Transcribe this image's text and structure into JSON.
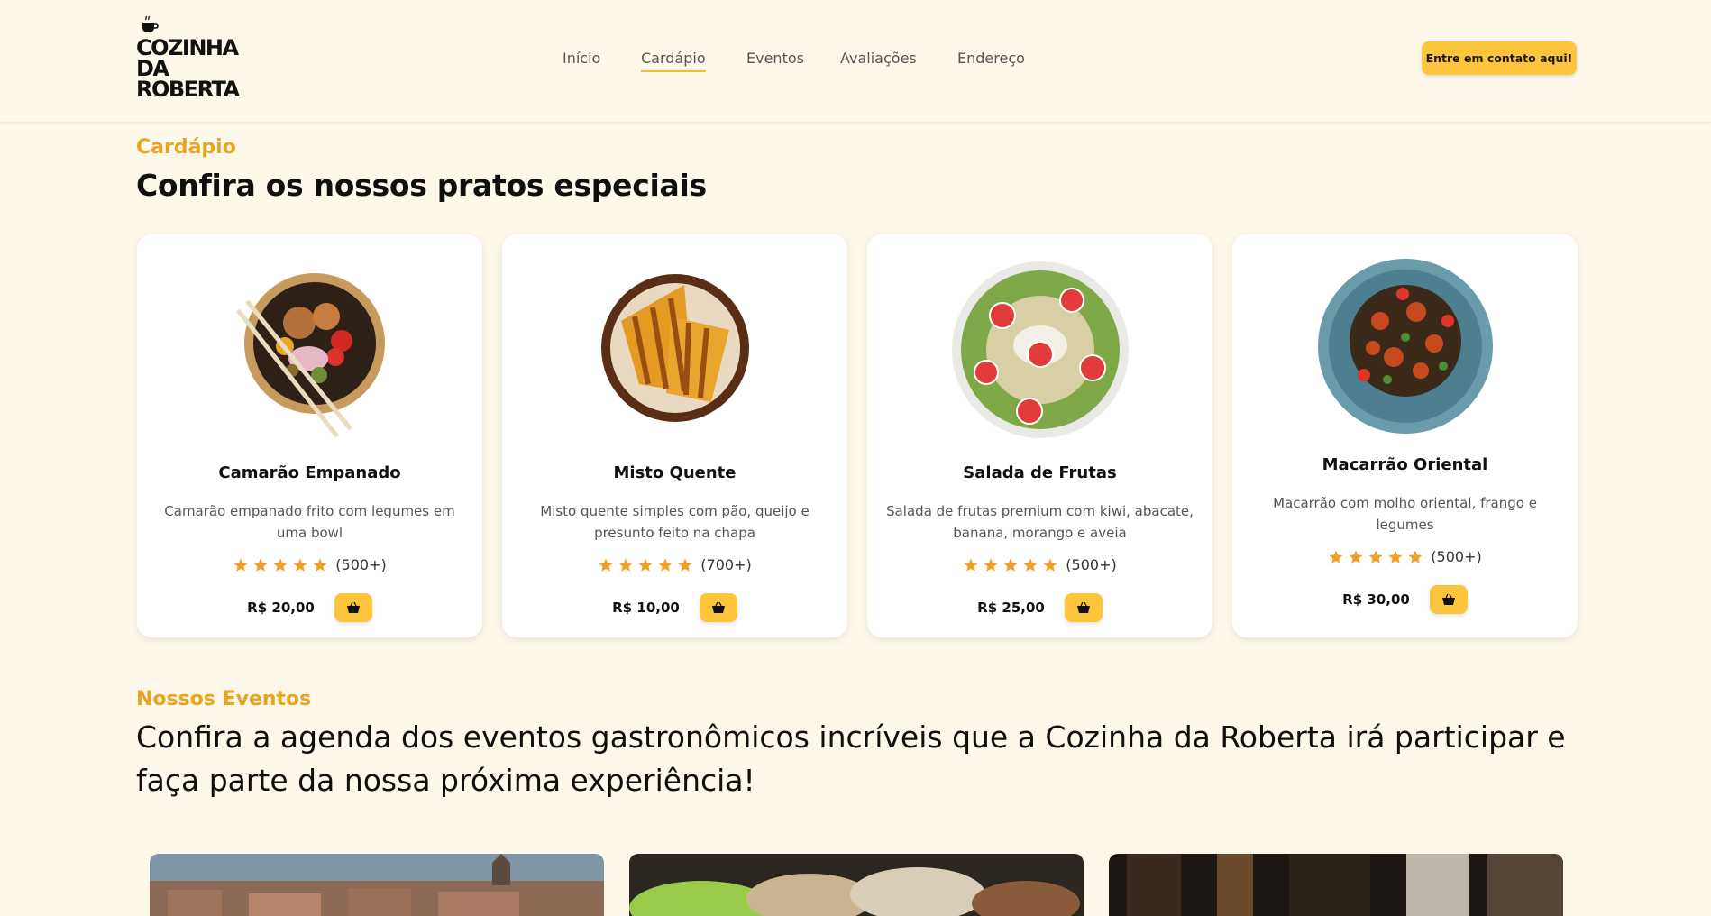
{
  "brand": {
    "line1": "COZINHA",
    "line2": "DA",
    "line3": "ROBERTA",
    "logo_icon": "coffee-cup-icon"
  },
  "nav": {
    "items": [
      {
        "label": "Início",
        "active": false
      },
      {
        "label": "Cardápio",
        "active": true
      },
      {
        "label": "Eventos",
        "active": false
      },
      {
        "label": "Avaliações",
        "active": false
      },
      {
        "label": "Endereço",
        "active": false
      }
    ],
    "cta_label": "Entre em contato aqui!"
  },
  "menu": {
    "eyebrow": "Cardápio",
    "title": "Confira os nossos pratos especiais",
    "items": [
      {
        "name": "Camarão Empanado",
        "description": "Camarão empanado frito com legumes em uma bowl",
        "stars": 5,
        "rating_count": "(500+)",
        "price": "R$ 20,00",
        "cart_icon": "basket-icon"
      },
      {
        "name": "Misto Quente",
        "description": "Misto quente simples com pão, queijo e presunto feito na chapa",
        "stars": 5,
        "rating_count": "(700+)",
        "price": "R$ 10,00",
        "cart_icon": "basket-icon"
      },
      {
        "name": "Salada de Frutas",
        "description": "Salada de frutas premium com kiwi, abacate, banana, morango e aveia",
        "stars": 5,
        "rating_count": "(500+)",
        "price": "R$ 25,00",
        "cart_icon": "basket-icon"
      },
      {
        "name": "Macarrão Oriental",
        "description": "Macarrão com molho oriental, frango e legumes",
        "stars": 5,
        "rating_count": "(500+)",
        "price": "R$ 30,00",
        "cart_icon": "basket-icon"
      }
    ]
  },
  "events": {
    "eyebrow": "Nossos Eventos",
    "title": "Confira a agenda dos eventos gastronômicos incríveis que a Cozinha da Roberta irá participar e faça parte da nossa próxima experiência!"
  },
  "colors": {
    "background": "#fdf8ea",
    "accent": "#fcc53c",
    "eyebrow": "#e8a521",
    "star": "#f0a024"
  }
}
